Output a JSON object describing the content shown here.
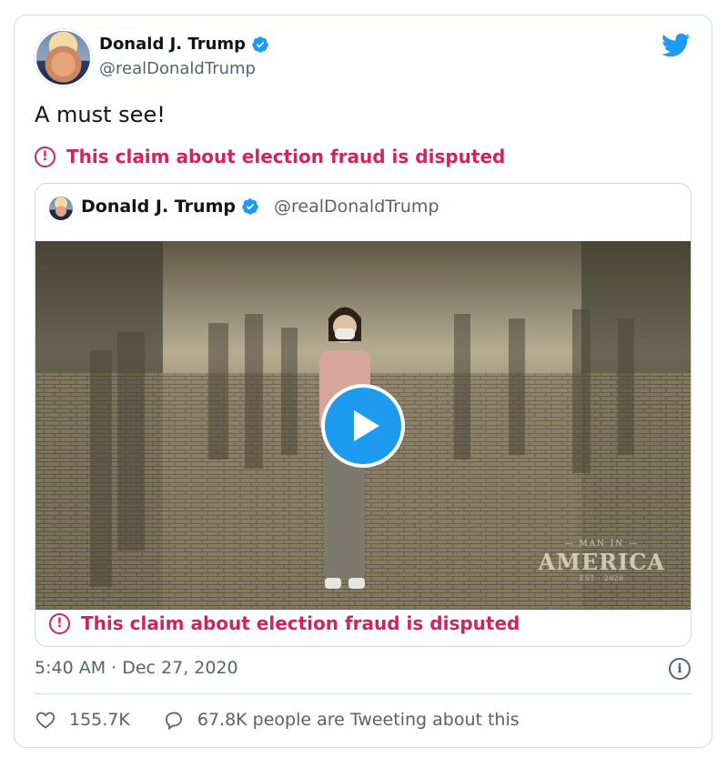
{
  "tweet": {
    "author_name": "Donald J. Trump",
    "author_handle": "@realDonaldTrump",
    "text": "A must see!",
    "disputed_notice": "This claim about election fraud is disputed",
    "timestamp": "5:40 AM · Dec 27, 2020",
    "likes": "155.7K",
    "conversation": "67.8K people are Tweeting about this"
  },
  "quoted_tweet": {
    "author_name": "Donald J. Trump",
    "author_handle": "@realDonaldTrump",
    "disputed_notice": "This claim about election fraud is disputed",
    "video_watermark": {
      "line1": "— MAN IN —",
      "line2": "AMERICA",
      "line3": "EST · 2020"
    }
  },
  "icons": {
    "verified": "verified-badge-icon",
    "brand": "twitter-bird-icon",
    "alert": "alert-circle-icon",
    "play": "play-icon",
    "info": "info-icon",
    "like": "heart-icon",
    "reply": "speech-bubble-icon"
  },
  "colors": {
    "accent": "#1d9bf0",
    "dispute": "#d2235c",
    "muted": "#536471",
    "border": "#cfd9de"
  }
}
